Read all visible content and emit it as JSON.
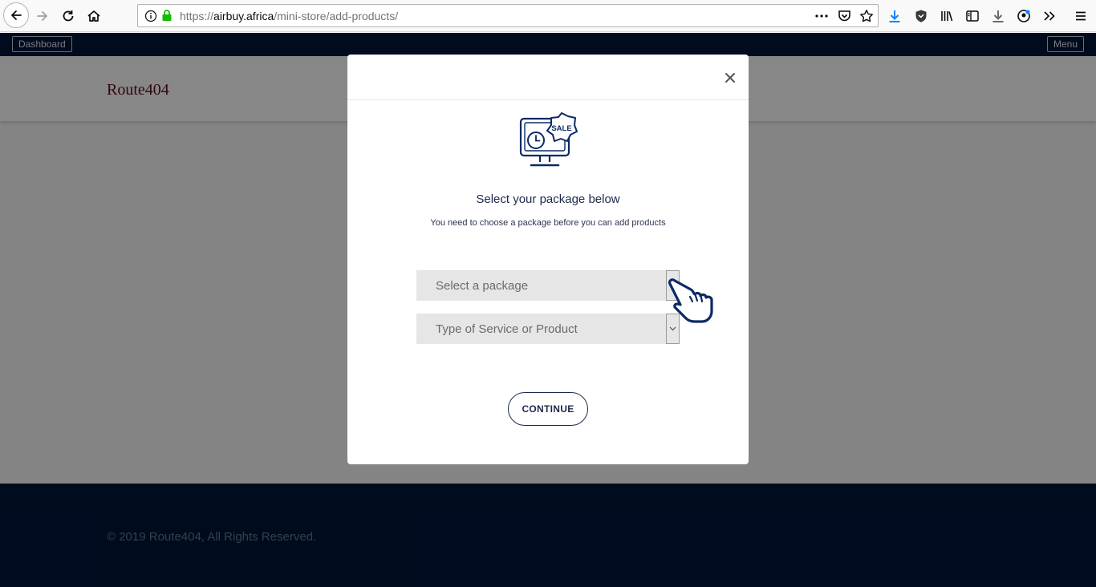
{
  "browser": {
    "url_prefix": "https://",
    "url_domain": "airbuy.africa",
    "url_path": "/mini-store/add-products/"
  },
  "topbar": {
    "dashboard_label": "Dashboard",
    "menu_label": "Menu"
  },
  "header": {
    "logo": "Route404"
  },
  "modal": {
    "icon_badge": "SALE",
    "title": "Select your package below",
    "subtitle": "You need to choose a package before you can add products",
    "package_select": {
      "value": "Select a package"
    },
    "service_select": {
      "value": "Type of Service or Product"
    },
    "continue_label": "CONTINUE"
  },
  "footer": {
    "copyright": "© 2019 Route404, All Rights Reserved."
  },
  "colors": {
    "navy": "#00153a",
    "modal_text": "#1b2a4a",
    "overlay": "rgba(0,0,0,0.47)",
    "lock_green": "#12bc00",
    "download_blue": "#0a84ff"
  }
}
